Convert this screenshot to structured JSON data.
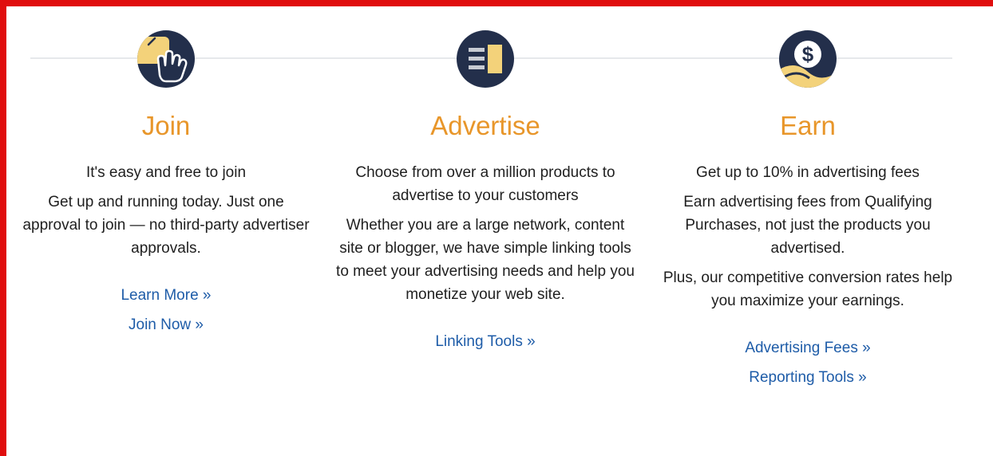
{
  "columns": {
    "join": {
      "icon": "hand-pointer-icon",
      "title": "Join",
      "lead": "It's easy and free to join",
      "paragraphs": [
        "Get up and running today. Just one approval to join — no third-party advertiser approvals."
      ],
      "links": [
        "Learn More »",
        "Join Now »"
      ]
    },
    "advertise": {
      "icon": "ad-panel-icon",
      "title": "Advertise",
      "lead": "Choose from over a million products to advertise to your customers",
      "paragraphs": [
        "Whether you are a large network, content site or blogger, we have simple linking tools to meet your advertising needs and help you monetize your web site."
      ],
      "links": [
        "Linking Tools »"
      ]
    },
    "earn": {
      "icon": "dollar-coin-icon",
      "title": "Earn",
      "lead": "Get up to 10% in advertising fees",
      "paragraphs": [
        "Earn advertising fees from Qualifying Purchases, not just the products you advertised.",
        "Plus, our competitive conversion rates help you maximize your earnings."
      ],
      "links": [
        "Advertising Fees »",
        "Reporting Tools »"
      ]
    }
  },
  "colors": {
    "border": "#e00d0d",
    "title_orange": "#e8962a",
    "link_blue": "#1e5ca8",
    "icon_navy": "#232f4b",
    "icon_gold": "#f3d27a"
  }
}
